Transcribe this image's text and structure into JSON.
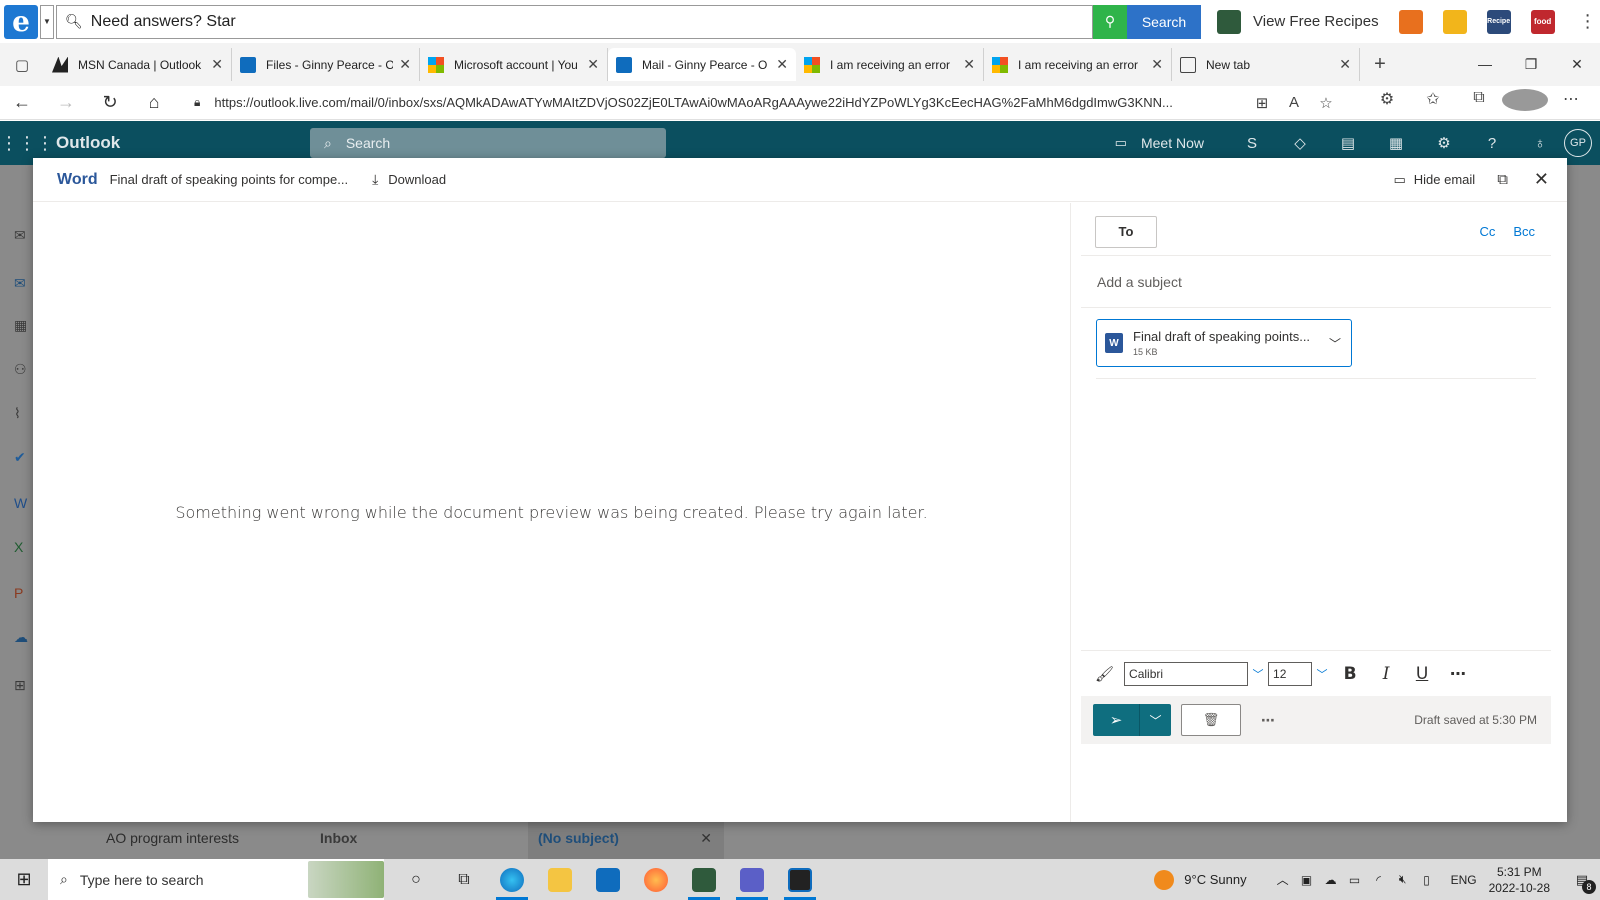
{
  "toolbar": {
    "search_placeholder": "Need answers? Star",
    "search_button": "Search",
    "recipes_label": "View Free Recipes",
    "ext_icons": [
      "recipe-ext-icon",
      "utensils-ext-icon",
      "recipe-book-ext-icon",
      "food-ext-icon"
    ],
    "ext_labels": [
      "",
      "",
      "Recipe",
      "food"
    ]
  },
  "tabs": [
    {
      "title": "MSN Canada | Outlook",
      "icon": "msn-icon"
    },
    {
      "title": "Files - Ginny Pearce - O",
      "icon": "outlook-icon"
    },
    {
      "title": "Microsoft account | You",
      "icon": "microsoft-icon"
    },
    {
      "title": "Mail - Ginny Pearce - O",
      "icon": "outlook-icon",
      "active": true
    },
    {
      "title": "I am receiving an error",
      "icon": "microsoft-icon"
    },
    {
      "title": "I am receiving an error",
      "icon": "microsoft-icon"
    },
    {
      "title": "New tab",
      "icon": "newtab-icon"
    }
  ],
  "address": {
    "url": "https://outlook.live.com/mail/0/inbox/sxs/AQMkADAwATYwMAItZDVjOS02ZjE0LTAwAi0wMAoARgAAAywe22iHdYZPoWLYg3KcEecHAG%2FaMhM6dgdImwG3KNN..."
  },
  "owa": {
    "brand": "Outlook",
    "search_placeholder": "Search",
    "meet_now": "Meet Now",
    "avatar_initials": "GP"
  },
  "background": {
    "folder": "AO program interests",
    "inbox": "Inbox",
    "draft_tab": "(No subject)"
  },
  "modal": {
    "app_name": "Word",
    "file_name": "Final draft of speaking points for compe...",
    "download": "Download",
    "hide_email": "Hide email",
    "preview_message": "Something went wrong while the document preview was being created. Please try again later."
  },
  "compose": {
    "to_label": "To",
    "cc_label": "Cc",
    "bcc_label": "Bcc",
    "subject_placeholder": "Add a subject",
    "attachment": {
      "name": "Final draft of speaking points...",
      "size": "15 KB"
    },
    "format": {
      "font": "Calibri",
      "size": "12",
      "bold": "B",
      "italic": "I",
      "underline": "U"
    },
    "draft_status": "Draft saved at 5:30 PM"
  },
  "taskbar": {
    "search_placeholder": "Type here to search",
    "weather": "9°C  Sunny",
    "language": "ENG",
    "time": "5:31 PM",
    "date": "2022-10-28",
    "notification_count": "8"
  },
  "colors": {
    "outlook_header": "#0b4f5f",
    "word_blue": "#2b579a",
    "send_teal": "#0f6e7f",
    "link_blue": "#0078d4"
  }
}
